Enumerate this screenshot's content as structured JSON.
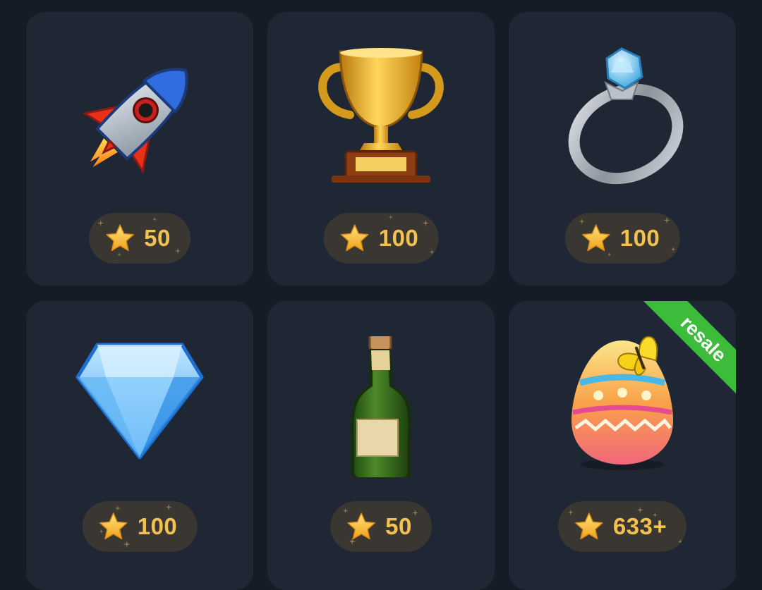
{
  "gifts": [
    {
      "name": "rocket",
      "price": "50",
      "badge": ""
    },
    {
      "name": "trophy",
      "price": "100",
      "badge": ""
    },
    {
      "name": "ring",
      "price": "100",
      "badge": ""
    },
    {
      "name": "diamond",
      "price": "100",
      "badge": ""
    },
    {
      "name": "champagne",
      "price": "50",
      "badge": ""
    },
    {
      "name": "easter-egg",
      "price": "633+",
      "badge": "resale"
    }
  ],
  "colors": {
    "background": "#151c25",
    "card": "#1e2733",
    "price_pill": "#3a3732",
    "price_text": "#f2c14f",
    "star": "#f5b731",
    "resale_ribbon": "#3dbb3a"
  },
  "icons": {
    "currency": "star-icon"
  }
}
